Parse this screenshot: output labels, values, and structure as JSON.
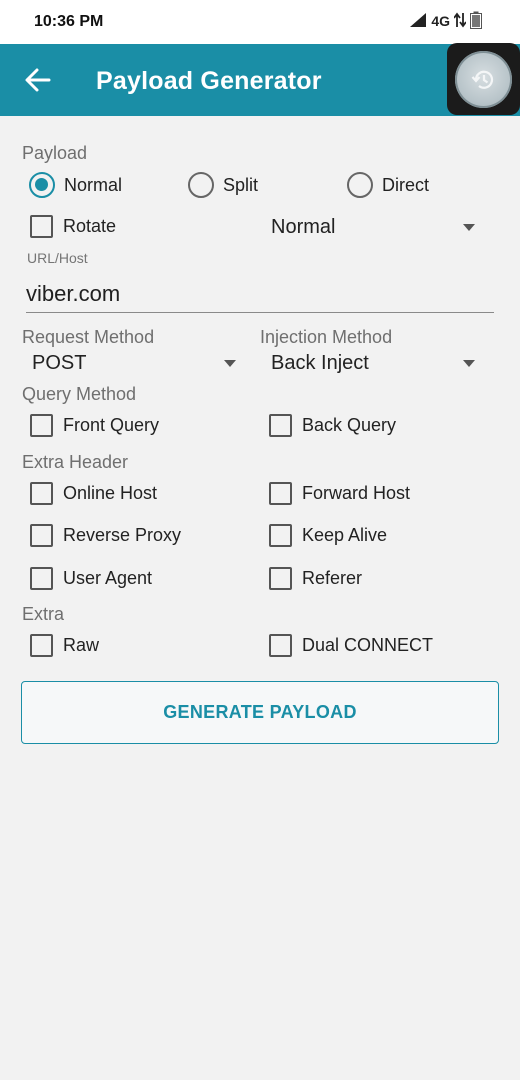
{
  "status": {
    "time": "10:36 PM",
    "network": "4G"
  },
  "toolbar": {
    "title": "Payload Generator"
  },
  "payload": {
    "label": "Payload",
    "options": [
      "Normal",
      "Split",
      "Direct"
    ],
    "selected": "Normal",
    "rotate_label": "Rotate",
    "rotate_mode": "Normal"
  },
  "url": {
    "label": "URL/Host",
    "value": "viber.com"
  },
  "request_method": {
    "label": "Request Method",
    "value": "POST"
  },
  "injection_method": {
    "label": "Injection Method",
    "value": "Back Inject"
  },
  "query_method": {
    "label": "Query Method",
    "options": [
      "Front Query",
      "Back Query"
    ]
  },
  "extra_header": {
    "label": "Extra Header",
    "options": [
      "Online Host",
      "Forward Host",
      "Reverse Proxy",
      "Keep Alive",
      "User Agent",
      "Referer"
    ]
  },
  "extra": {
    "label": "Extra",
    "options": [
      "Raw",
      "Dual CONNECT"
    ]
  },
  "generate_label": "GENERATE PAYLOAD",
  "colors": {
    "accent": "#1a8ea6",
    "background": "#f2f2f2"
  }
}
